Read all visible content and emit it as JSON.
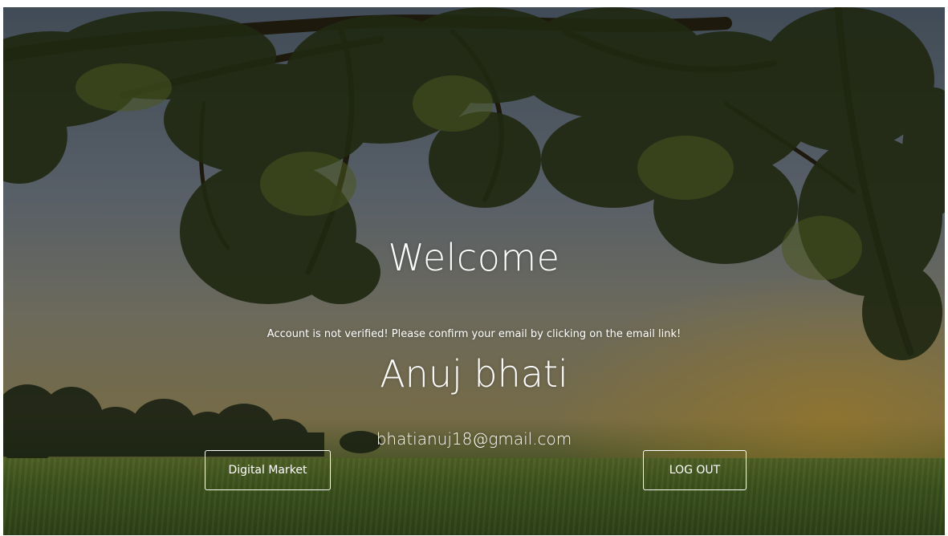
{
  "hero": {
    "welcome_title": "Welcome",
    "verification_notice": "Account is not verified! Please confirm your email by clicking on the email link!",
    "user_name": "Anuj bhati",
    "user_email": "bhatianuj18@gmail.com"
  },
  "actions": {
    "digital_market_label": "Digital Market",
    "logout_label": "LOG OUT"
  },
  "colors": {
    "text": "#ffffff",
    "button_border": "#ffffff"
  }
}
